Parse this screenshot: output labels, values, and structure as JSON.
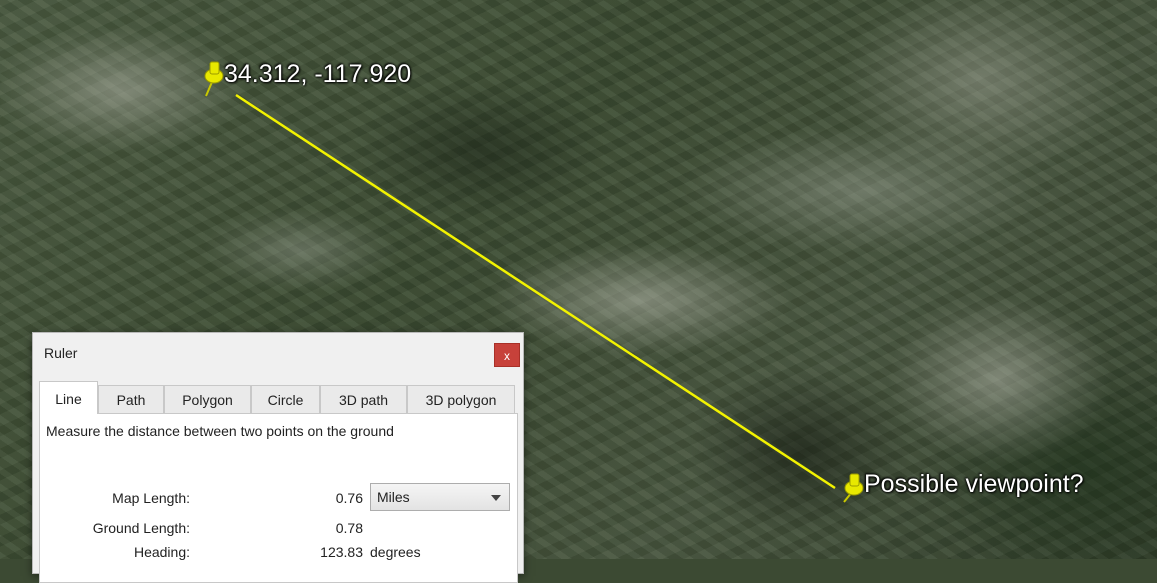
{
  "map": {
    "start_label": "34.312, -117.920",
    "end_label": "Possible viewpoint?",
    "line_color": "#f2f200",
    "pin_color": "#e8e800"
  },
  "ruler": {
    "title": "Ruler",
    "close_glyph": "x",
    "tabs": [
      {
        "label": "Line",
        "active": true
      },
      {
        "label": "Path",
        "active": false
      },
      {
        "label": "Polygon",
        "active": false
      },
      {
        "label": "Circle",
        "active": false
      },
      {
        "label": "3D path",
        "active": false
      },
      {
        "label": "3D polygon",
        "active": false
      }
    ],
    "description": "Measure the distance between two points on the ground",
    "map_length_label": "Map Length:",
    "map_length_value": "0.76",
    "unit_selected": "Miles",
    "ground_length_label": "Ground Length:",
    "ground_length_value": "0.78",
    "heading_label": "Heading:",
    "heading_value": "123.83",
    "heading_unit": "degrees",
    "close_color": "#c7413a"
  }
}
